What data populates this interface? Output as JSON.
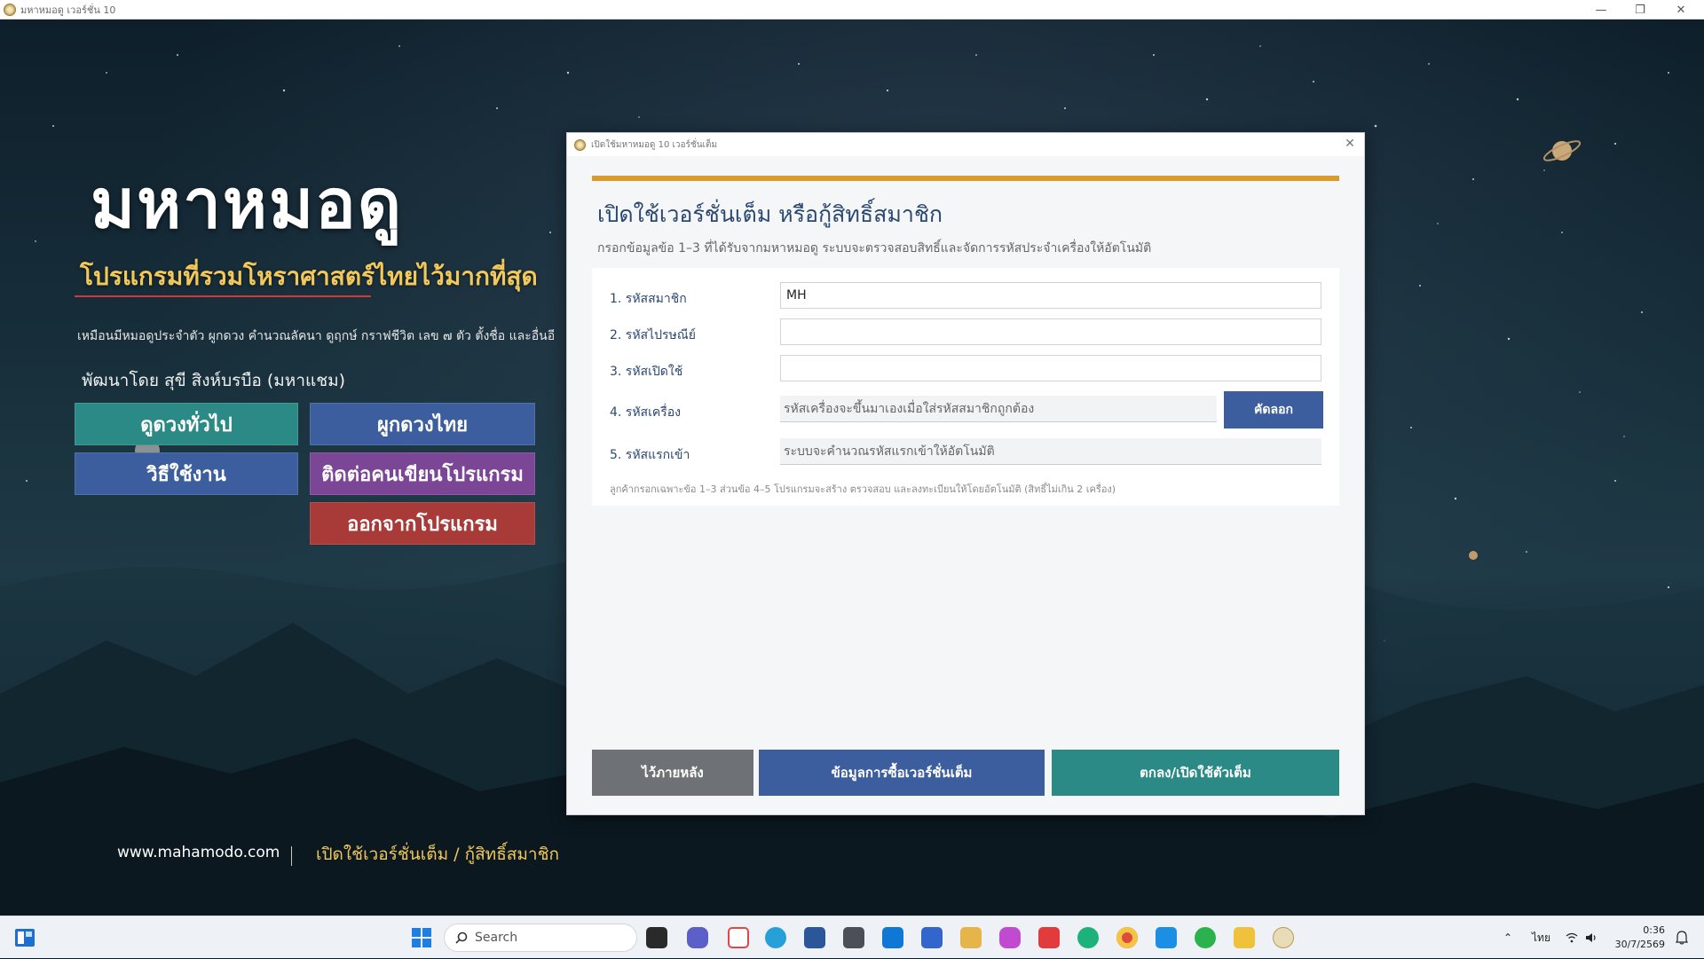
{
  "window": {
    "title": "มหาหมอดู เวอร์ชั่น 10",
    "minimize": "—",
    "maximize": "❐",
    "close": "✕"
  },
  "hero": {
    "title": "มหาหมอดู",
    "subtitle": "โปรแกรมที่รวมโหราศาสตร์ไทยไว้มากที่สุด",
    "description": "เหมือนมีหมอดูประจำตัว ผูกดวง คำนวณลัคนา ดูฤกษ์ กราฟชีวิต เลข ๗ ตัว ตั้งชื่อ และอื่นอี",
    "developer": "พัฒนาโดย สุขี สิงห์บรบือ (มหาแชม)"
  },
  "menu": {
    "general_reading": "ดูดวงทั่วไป",
    "thai_chart": "ผูกดวงไทย",
    "how_to_use": "วิธีใช้งาน",
    "contact_developer": "ติดต่อคนเขียนโปรแกรม",
    "exit_program": "ออกจากโปรแกรม"
  },
  "footer": {
    "website": "www.mahamodo.com",
    "separator": "|",
    "activate_link": "เปิดใช้เวอร์ชั่นเต็ม / กู้สิทธิ์สมาชิก"
  },
  "dialog": {
    "title": "เปิดใช้มหาหมอดู 10 เวอร์ชั่นเต็ม",
    "close": "✕",
    "heading": "เปิดใช้เวอร์ชั่นเต็ม หรือกู้สิทธิ์สมาชิก",
    "description": "กรอกข้อมูลข้อ 1–3 ที่ได้รับจากมหาหมอดู ระบบจะตรวจสอบสิทธิ์และจัดการรหัสประจำเครื่องให้อัตโนมัติ",
    "fields": {
      "member_code": {
        "label": "1. รหัสสมาชิก",
        "value": "MH",
        "placeholder": ""
      },
      "postal_code": {
        "label": "2. รหัสไปรษณีย์",
        "value": "",
        "placeholder": ""
      },
      "activation_code": {
        "label": "3. รหัสเปิดใช้",
        "value": "",
        "placeholder": ""
      },
      "machine_code": {
        "label": "4. รหัสเครื่อง",
        "value": "รหัสเครื่องจะขึ้นมาเองเมื่อใส่รหัสสมาชิกถูกต้อง"
      },
      "first_login_code": {
        "label": "5. รหัสแรกเข้า",
        "value": "ระบบจะคำนวณรหัสแรกเข้าให้อัตโนมัติ"
      }
    },
    "copy_button": "คัดลอก",
    "hint": "ลูกค้ากรอกเฉพาะข้อ 1–3 ส่วนข้อ 4–5 โปรแกรมจะสร้าง ตรวจสอบ และลงทะเบียนให้โดยอัตโนมัติ (สิทธิ์ไม่เกิน 2 เครื่อง)",
    "buttons": {
      "later": "ไว้ภายหลัง",
      "purchase_info": "ข้อมูลการซื้อเวอร์ชั่นเต็ม",
      "ok_activate": "ตกลง/เปิดใช้ตัวเต็ม"
    }
  },
  "taskbar": {
    "search_label": "Search",
    "language": "ไทย",
    "time": "0:36",
    "date": "30/7/2569"
  },
  "colors": {
    "teal": "#2c8a86",
    "blue": "#3c5e9e",
    "purple": "#7c4696",
    "red": "#a83a38",
    "gold": "#f2c85a",
    "accent_bar": "#d99a2f",
    "gray_button": "#6e7175"
  }
}
